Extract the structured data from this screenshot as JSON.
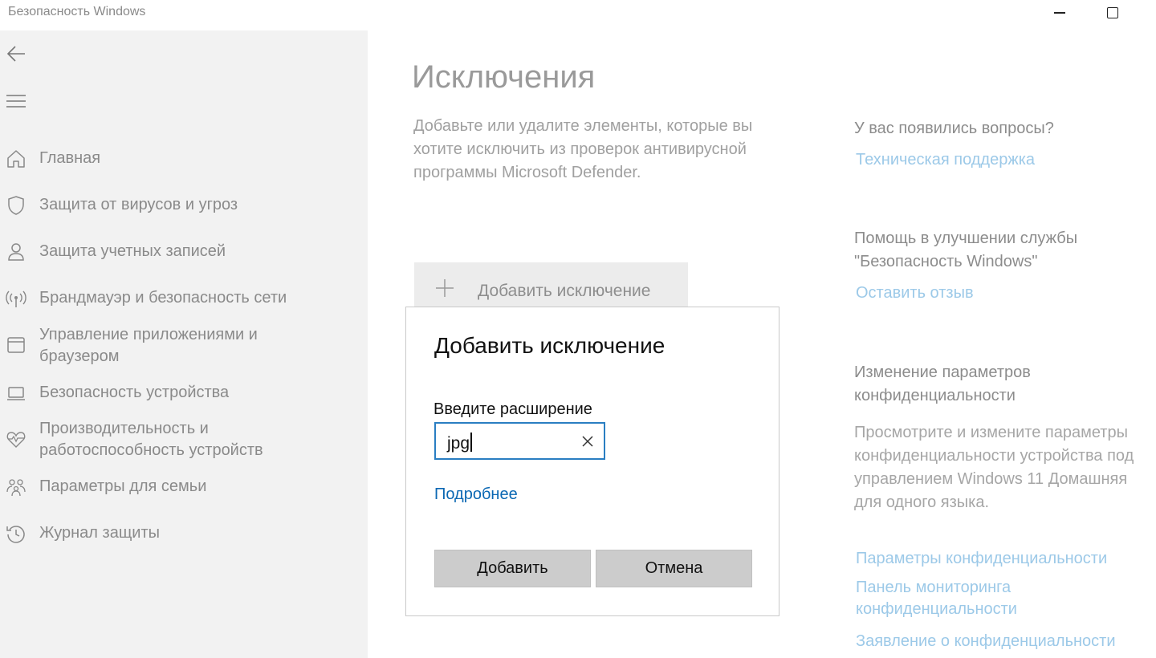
{
  "window": {
    "title": "Безопасность Windows"
  },
  "sidebar": {
    "items": [
      {
        "label": "Главная",
        "icon": "home-icon"
      },
      {
        "label": "Защита от вирусов и угроз",
        "icon": "shield-icon"
      },
      {
        "label": "Защита учетных записей",
        "icon": "person-icon"
      },
      {
        "label": "Брандмауэр и безопасность сети",
        "icon": "antenna-icon"
      },
      {
        "label": "Управление приложениями и браузером",
        "icon": "browser-icon"
      },
      {
        "label": "Безопасность устройства",
        "icon": "laptop-icon"
      },
      {
        "label": "Производительность и работоспособность устройств",
        "icon": "heart-pulse-icon"
      },
      {
        "label": "Параметры для семьи",
        "icon": "family-icon"
      },
      {
        "label": "Журнал защиты",
        "icon": "history-icon"
      }
    ]
  },
  "main": {
    "title": "Исключения",
    "description": "Добавьте или удалите элементы, которые вы хотите исключить из проверок антивирусной программы Microsoft Defender.",
    "add_exclusion_label": "Добавить исключение"
  },
  "right": {
    "questions_heading": "У вас появились вопросы?",
    "support_link": "Техническая поддержка",
    "improve_heading": "Помощь в улучшении службы \"Безопасность Windows\"",
    "feedback_link": "Оставить отзыв",
    "privacy_heading": "Изменение параметров конфиденциальности",
    "privacy_text": "Просмотрите и измените параметры конфиденциальности устройства под управлением Windows 11 Домашняя для одного языка.",
    "privacy_settings_link": "Параметры конфиденциальности",
    "privacy_dashboard_link": "Панель мониторинга конфиденциальности",
    "privacy_statement_link": "Заявление о конфиденциальности"
  },
  "dialog": {
    "title": "Добавить исключение",
    "field_label": "Введите расширение",
    "field_value": "jpg",
    "more_link": "Подробнее",
    "add_button": "Добавить",
    "cancel_button": "Отмена"
  },
  "colors": {
    "link": "#9cc9e8",
    "accent": "#2a7ec2",
    "dialog_link": "#0a67b3"
  }
}
